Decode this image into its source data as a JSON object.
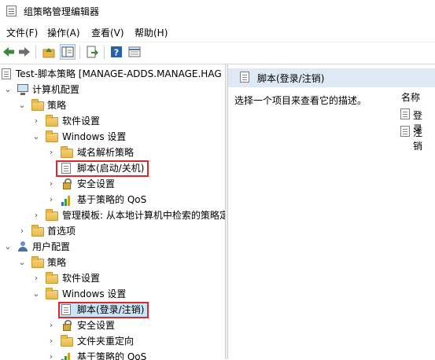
{
  "window": {
    "title": "组策略管理编辑器"
  },
  "menu": [
    "文件(F)",
    "操作(A)",
    "查看(V)",
    "帮助(H)"
  ],
  "toolbar": {
    "icons": [
      "back-arrow-icon",
      "forward-arrow-icon",
      "up-folder-icon",
      "show-hide-tree-icon",
      "export-list-icon",
      "help-icon",
      "properties-icon"
    ]
  },
  "tree": {
    "root": "Test-脚本策略 [MANAGE-ADDS.MANAGE.HAG",
    "computer_config": "计算机配置",
    "cc_policies": "策略",
    "cc_software": "软件设置",
    "cc_windows": "Windows 设置",
    "cc_dns": "域名解析策略",
    "cc_scripts": "脚本(启动/关机)",
    "cc_security": "安全设置",
    "cc_qos": "基于策略的 QoS",
    "cc_admin_templates": "管理模板: 从本地计算机中检索的策略定",
    "cc_preferences": "首选项",
    "user_config": "用户配置",
    "uc_policies": "策略",
    "uc_software": "软件设置",
    "uc_windows": "Windows 设置",
    "uc_scripts": "脚本(登录/注销)",
    "uc_security": "安全设置",
    "uc_folder_redirect": "文件夹重定向",
    "uc_qos": "基于策略的 QoS"
  },
  "details": {
    "title": "脚本(登录/注销)",
    "description": "选择一个项目来查看它的描述。",
    "column_name": "名称",
    "items": [
      "登录",
      "注销"
    ]
  },
  "colors": {
    "highlight_border": "#e02828",
    "header_bg": "#dfe9f6"
  }
}
